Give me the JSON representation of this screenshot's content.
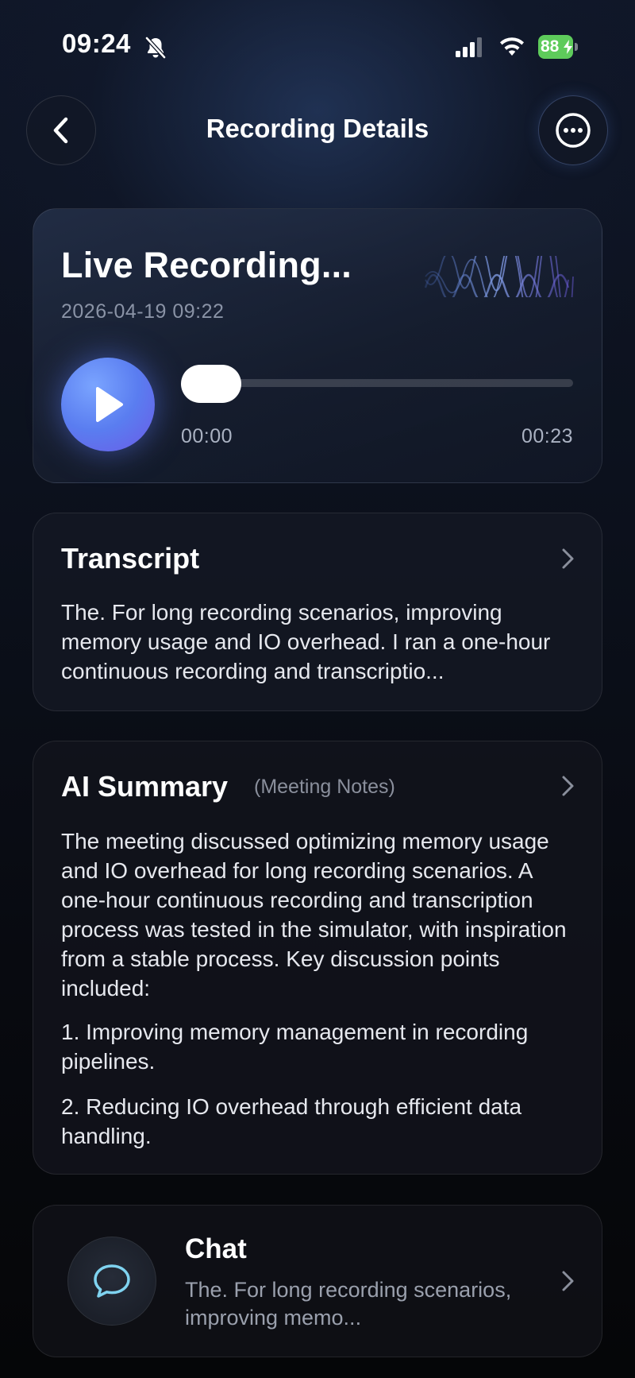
{
  "status_bar": {
    "time": "09:24",
    "battery": "88",
    "icons": [
      "bell-slash-icon",
      "cellular-signal-icon",
      "wifi-icon",
      "battery-charging-icon"
    ]
  },
  "nav": {
    "title": "Recording Details",
    "back_icon": "chevron-left-icon",
    "more_icon": "ellipsis-circle-icon"
  },
  "recording": {
    "title": "Live Recording...",
    "date": "2026-04-19 09:22",
    "current_time": "00:00",
    "duration": "00:23",
    "progress": 0,
    "play_icon": "play-icon",
    "wave_icon": "waveform-icon",
    "accent_color": "#5a7df0"
  },
  "transcript": {
    "title": "Transcript",
    "text": "The. For long recording scenarios, improving memory usage and IO overhead. I ran a one-hour continuous recording and transcriptio..."
  },
  "summary": {
    "title": "AI Summary",
    "tag": "(Meeting Notes)",
    "paragraphs": [
      "The meeting discussed optimizing memory usage and IO overhead for long recording scenarios. A one-hour continuous recording and transcription process was tested in the simulator, with inspiration from a stable process. Key discussion points included:",
      "1. Improving memory management in recording pipelines.",
      "2. Reducing IO overhead through efficient data handling."
    ]
  },
  "chat": {
    "title": "Chat",
    "text": "The. For long recording scenarios, improving memo...",
    "icon": "chat-bubble-icon",
    "icon_color": "#7fd3f0"
  }
}
